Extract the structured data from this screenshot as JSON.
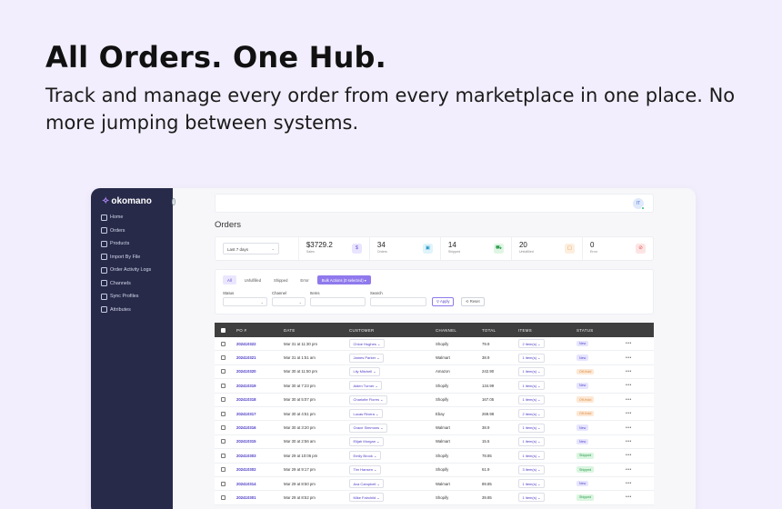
{
  "hero": {
    "title": "All Orders. One Hub.",
    "subtitle": "Track and manage every order from every marketplace in one place. No more jumping between systems."
  },
  "app": {
    "brand": "okomano",
    "nav": [
      "Home",
      "Orders",
      "Products",
      "Import By File",
      "Order Activity Logs",
      "Channels",
      "Sync Profiles",
      "Attributes"
    ],
    "user_initials": "IT",
    "page_title": "Orders",
    "date_range": "Last 7 days",
    "stats": [
      {
        "value": "$3729.2",
        "label": "Sales",
        "icon": "$",
        "color": "#e9e4ff",
        "icon_color": "#6b55d8"
      },
      {
        "value": "34",
        "label": "Orders",
        "icon": "▣",
        "color": "#dff4fb",
        "icon_color": "#2a9ac4"
      },
      {
        "value": "14",
        "label": "Shipped",
        "icon": "⛟",
        "color": "#dff6e4",
        "icon_color": "#2b9b4a"
      },
      {
        "value": "20",
        "label": "Unfulfilled",
        "icon": "▢",
        "color": "#fdeede",
        "icon_color": "#e0913f"
      },
      {
        "value": "0",
        "label": "Error",
        "icon": "⊘",
        "color": "#fde4e4",
        "icon_color": "#e05050"
      }
    ],
    "tabs": [
      "All",
      "Unfulfilled",
      "Shipped",
      "Error"
    ],
    "bulk_label": "Bulk Actions (0 selected) ▾",
    "filters": {
      "status": "Status",
      "channel": "Channel",
      "items": "Items",
      "search": "Search"
    },
    "apply_label": "Apply",
    "reset_label": "Reset",
    "columns": [
      "PO #",
      "DATE",
      "CUSTOMER",
      "CHANNEL",
      "TOTAL",
      "ITEMS",
      "STATUS"
    ],
    "rows": [
      {
        "po": "2024103​22",
        "date": "Mar 31 at 11:30 pm",
        "customer": "Chloe Hughes",
        "channel": "Shopify",
        "total": "79.9",
        "items": "2 item(s)",
        "status": "New",
        "st": "new"
      },
      {
        "po": "202410321",
        "date": "Mar 31 at 1:51 am",
        "customer": "James Parker",
        "channel": "Walmart",
        "total": "38.9",
        "items": "1 item(s)",
        "status": "New",
        "st": "new"
      },
      {
        "po": "202410320",
        "date": "Mar 30 at 11:50 pm",
        "customer": "Lily Mitchell",
        "channel": "Amazon",
        "total": "242.90",
        "items": "1 item(s)",
        "status": "Off-Hold",
        "st": "off"
      },
      {
        "po": "202410319",
        "date": "Mar 30 at 7:23 pm",
        "customer": "Aiden Turner",
        "channel": "Shopify",
        "total": "134.99",
        "items": "1 item(s)",
        "status": "New",
        "st": "new"
      },
      {
        "po": "202410318",
        "date": "Mar 30 at 5:07 pm",
        "customer": "Charlotte Flores",
        "channel": "Shopify",
        "total": "167.05",
        "items": "1 item(s)",
        "status": "Off-Hold",
        "st": "off"
      },
      {
        "po": "202410317",
        "date": "Mar 30 at 4:51 pm",
        "customer": "Lucas Rivera",
        "channel": "Ebay",
        "total": "269.98",
        "items": "2 item(s)",
        "status": "Off-Hold",
        "st": "off"
      },
      {
        "po": "202410316",
        "date": "Mar 30 at 3:20 pm",
        "customer": "Grace Simmons",
        "channel": "Walmart",
        "total": "38.9",
        "items": "1 item(s)",
        "status": "New",
        "st": "new"
      },
      {
        "po": "202410315",
        "date": "Mar 30 at 2:56 am",
        "customer": "Elijah Morgan",
        "channel": "Walmart",
        "total": "15.5",
        "items": "1 item(s)",
        "status": "New",
        "st": "new"
      },
      {
        "po": "202410303",
        "date": "Mar 29 at 10:06 pm",
        "customer": "Emily Brook",
        "channel": "Shopify",
        "total": "78.85",
        "items": "1 item(s)",
        "status": "Shipped",
        "st": "ship"
      },
      {
        "po": "202410302",
        "date": "Mar 29 at 9:17 pm",
        "customer": "Tim Hansen",
        "channel": "Shopify",
        "total": "61.9",
        "items": "3 item(s)",
        "status": "Shipped",
        "st": "ship"
      },
      {
        "po": "202410314",
        "date": "Mar 29 at 8:50 pm",
        "customer": "Ava Campbell",
        "channel": "Walmart",
        "total": "89.85",
        "items": "1 item(s)",
        "status": "New",
        "st": "new"
      },
      {
        "po": "202410301",
        "date": "Mar 29 at 8:52 pm",
        "customer": "Mike Fairchild",
        "channel": "Shopify",
        "total": "39.85",
        "items": "1 item(s)",
        "status": "Shipped",
        "st": "ship"
      }
    ]
  }
}
